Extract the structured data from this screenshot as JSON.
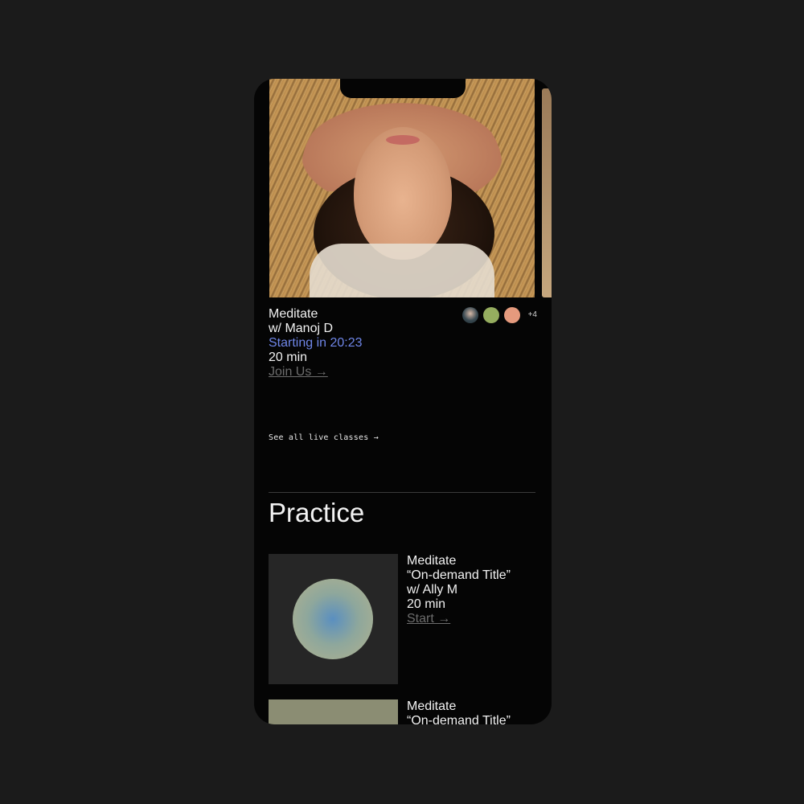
{
  "live_class": {
    "activity": "Meditate",
    "teacher": "w/ Manoj D",
    "countdown": "Starting in 20:23",
    "duration": "20 min",
    "cta": "Join Us →",
    "attendee_extra": "+4"
  },
  "see_all": "See all live classes →",
  "practice": {
    "title": "Practice",
    "items": [
      {
        "activity": "Meditate",
        "title": "“On-demand Title”",
        "teacher": "w/ Ally M",
        "duration": "20 min",
        "cta": "Start →"
      },
      {
        "activity": "Meditate",
        "title": "“On-demand Title”"
      }
    ]
  },
  "colors": {
    "background": "#1b1b1b",
    "phone": "#050505",
    "accent": "#6f86e8",
    "muted": "#6c6c6c",
    "avatar_green": "#95ad5f",
    "avatar_peach": "#e59a7d"
  }
}
